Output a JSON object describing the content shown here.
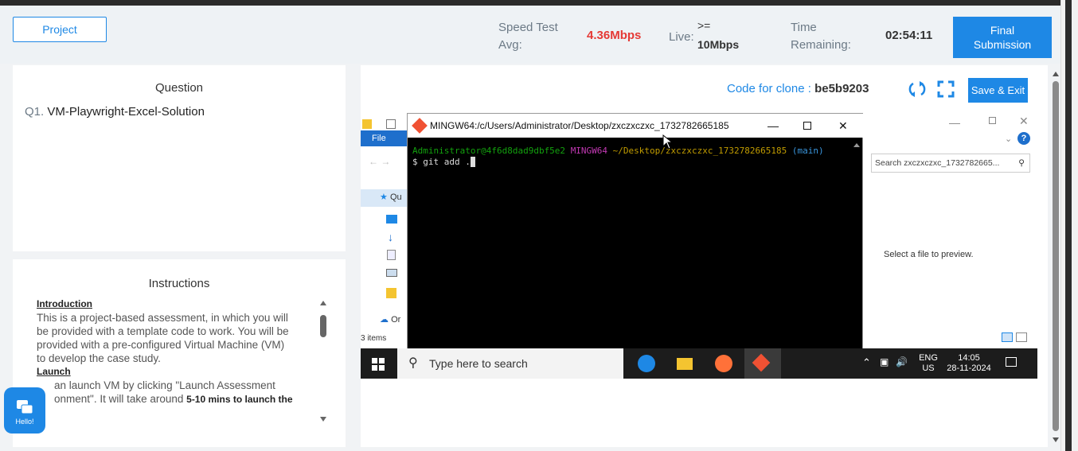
{
  "header": {
    "project_label": "Project",
    "speed_label_1": "Speed Test",
    "speed_label_2": "Avg:",
    "speed_value": "4.36Mbps",
    "live_label": "Live:",
    "live_ge": ">=",
    "live_value": "10Mbps",
    "time_label_1": "Time",
    "time_label_2": "Remaining:",
    "time_value": "02:54:11",
    "final_label_1": "Final",
    "final_label_2": "Submission"
  },
  "question": {
    "title": "Question",
    "number": "Q1.",
    "text": "VM-Playwright-Excel-Solution"
  },
  "instructions": {
    "title": "Instructions",
    "intro_heading": "Introduction",
    "intro_line1": "This is a project-based assessment, in which you will",
    "intro_line2": "be provided with a template code to work. You will be",
    "intro_line3": "provided with a pre-configured Virtual Machine (VM)",
    "intro_line4": "to develop the case study.",
    "launch_heading": "Launch",
    "launch_line1_a": "an launch VM by clicking \"Launch Assessment",
    "launch_line2_a": "onment\". It will take around ",
    "launch_line2_b": "5-10 mins to launch the"
  },
  "chat": {
    "label": "Hello!"
  },
  "vm_toolbar": {
    "clone_label": "Code for clone :",
    "clone_code": "be5b9203",
    "save_exit": "Save & Exit"
  },
  "terminal": {
    "title": "MINGW64:/c/Users/Administrator/Desktop/zxczxczxc_1732782665185",
    "prompt_user": "Administrator@4f6d8dad9dbf5e2",
    "prompt_shell": "MINGW64",
    "prompt_path": "~/Desktop/zxczxczxc_1732782665185",
    "prompt_branch": "(main)",
    "command": "$ git add ."
  },
  "explorer": {
    "file_tab": "File",
    "search_placeholder": "Search zxczxczxc_1732782665...",
    "preview_text": "Select a file to preview.",
    "items_count": "3 items",
    "side_quick": "Qu",
    "side_onedrive": "Or"
  },
  "taskbar": {
    "search_text": "Type here to search",
    "lang_1": "ENG",
    "lang_2": "US",
    "time": "14:05",
    "date": "28-11-2024"
  },
  "colors": {
    "accent": "#1e88e5",
    "speed_red": "#e53935",
    "term_green": "#13a10e",
    "term_magenta": "#c239b3",
    "term_yellow": "#c19c00",
    "term_cyan": "#3a96dd"
  }
}
